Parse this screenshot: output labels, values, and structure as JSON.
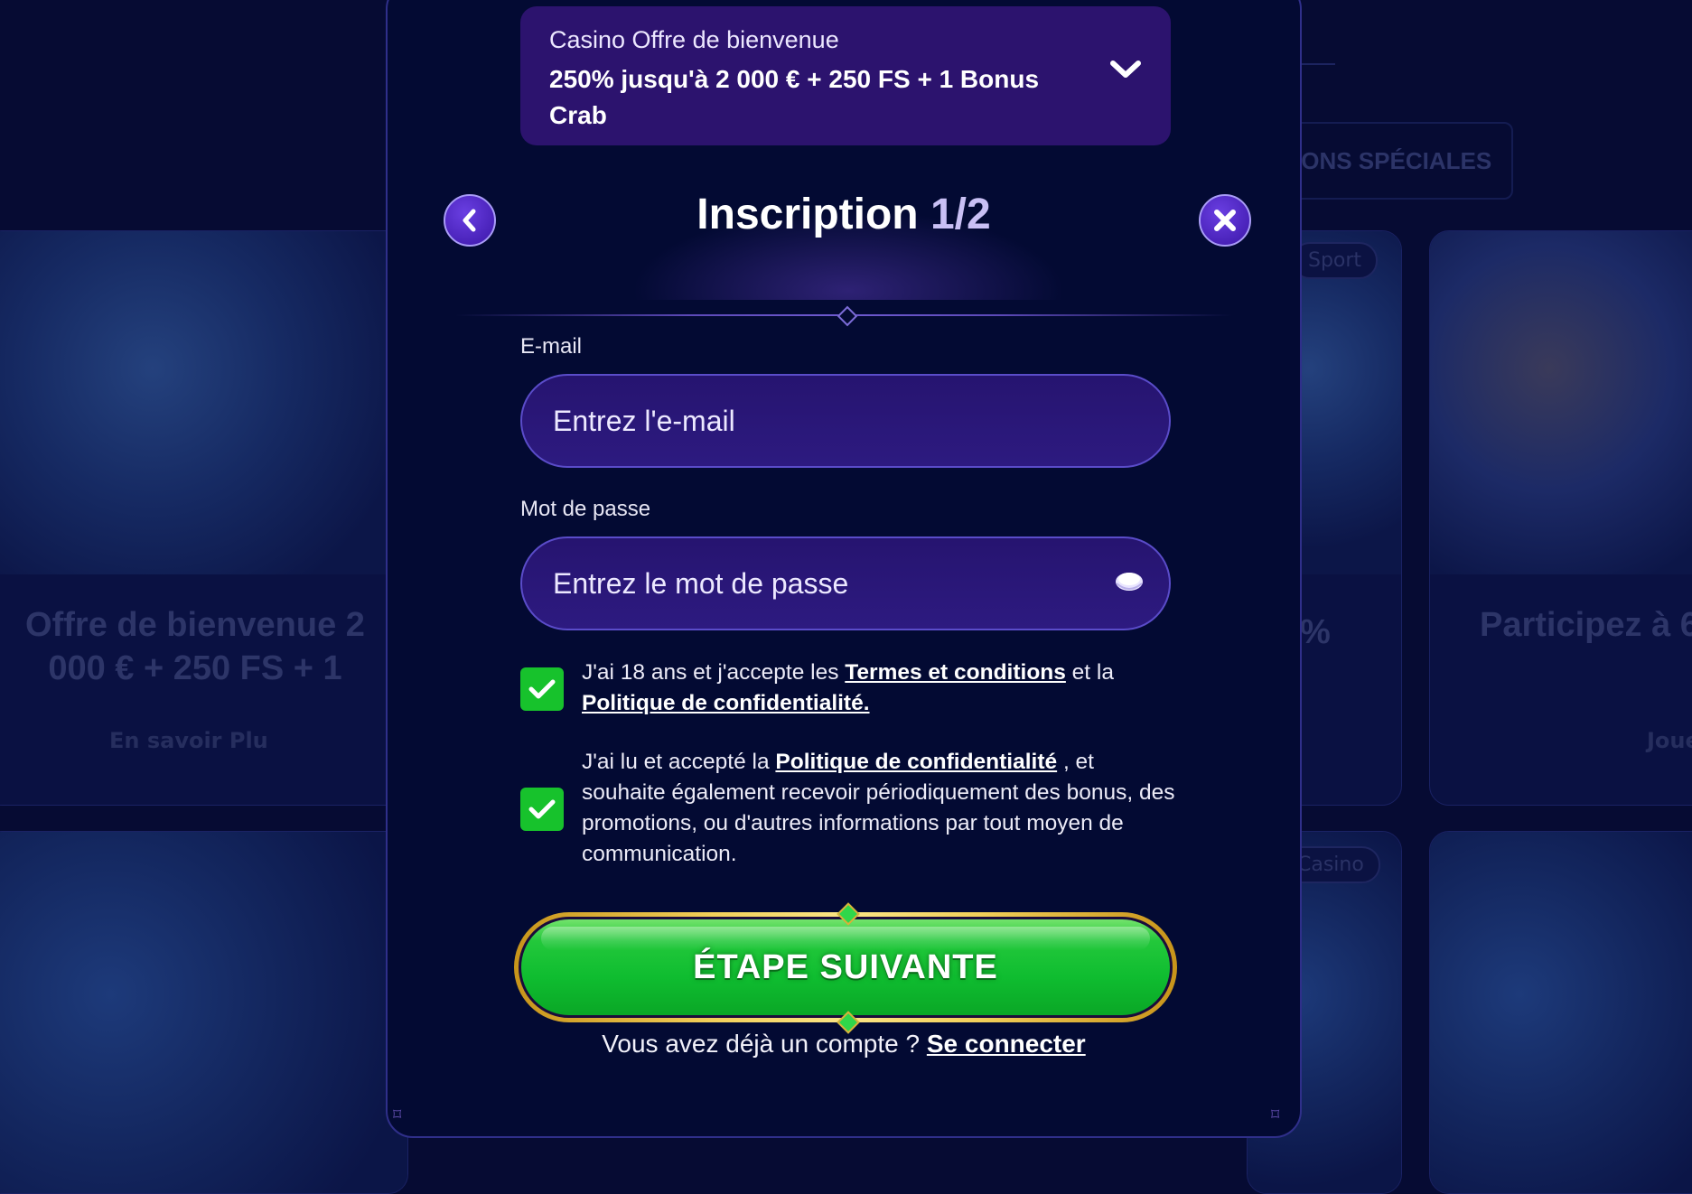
{
  "background": {
    "tab_label": "IONS SPÉCIALES",
    "tags": [
      "Sport",
      "Casino"
    ],
    "cards": [
      {
        "title": "Offre de bienvenue 2 000 € + 250 FS + 1",
        "link": "En savoir Plu"
      },
      {
        "title": "%",
        "link": ""
      },
      {
        "title": "Participez à 6",
        "link": "Joue"
      }
    ]
  },
  "offer": {
    "label": "Casino Offre de bienvenue",
    "value": "250% jusqu'à 2 000 € + 250 FS + 1 Bonus Crab"
  },
  "header": {
    "title": "Inscription",
    "step": "1/2"
  },
  "form": {
    "email_label": "E-mail",
    "email_placeholder": "Entrez l'e-mail",
    "email_value": "",
    "password_label": "Mot de passe",
    "password_placeholder": "Entrez le mot de passe",
    "password_value": ""
  },
  "consent": {
    "first": {
      "checked": true,
      "text_before": "J'ai 18 ans et j'accepte les ",
      "link_terms": "Termes et conditions",
      "text_middle": " et la ",
      "link_privacy": "Politique de confidentialité."
    },
    "second": {
      "checked": true,
      "text_before": "J'ai lu et accepté la ",
      "link_privacy": "Politique de confidentialité",
      "text_after": " , et souhaite également recevoir périodiquement des bonus, des promotions, ou d'autres informations par tout moyen de communication."
    }
  },
  "cta": {
    "label": "ÉTAPE SUIVANTE"
  },
  "login": {
    "text": "Vous avez déjà un compte ? ",
    "link": "Se connecter"
  },
  "colors": {
    "background": "#060b33",
    "modal": "#030a33",
    "offer": "#2c136e",
    "accent": "#5a4cc9",
    "checkbox": "#17c22c",
    "cta_green": "#0fbd30",
    "cta_gold": "#f2d05a"
  }
}
